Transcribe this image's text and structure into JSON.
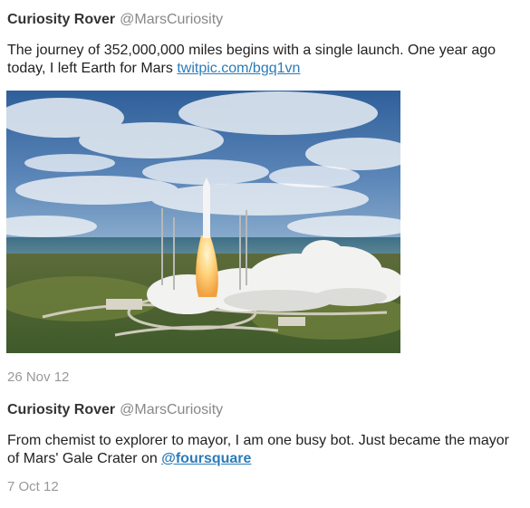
{
  "tweets": [
    {
      "author_name": "Curiosity Rover",
      "author_handle": "@MarsCuriosity",
      "text": "The journey of 352,000,000 miles begins with a single launch. One year ago today, I left Earth for Mars",
      "link_text": "twitpic.com/bgq1vn",
      "photo_icon": "rocket-launch-photo",
      "timestamp": "26 Nov 12"
    },
    {
      "author_name": "Curiosity Rover",
      "author_handle": "@MarsCuriosity",
      "text": "From chemist to explorer to mayor, I am one busy bot. Just became the mayor of Mars' Gale Crater on",
      "mention_text": "@foursquare",
      "timestamp": "7 Oct 12"
    }
  ],
  "colors": {
    "link": "#2b7bb9",
    "name": "#333333",
    "handle": "#888888",
    "timestamp": "#999999"
  }
}
